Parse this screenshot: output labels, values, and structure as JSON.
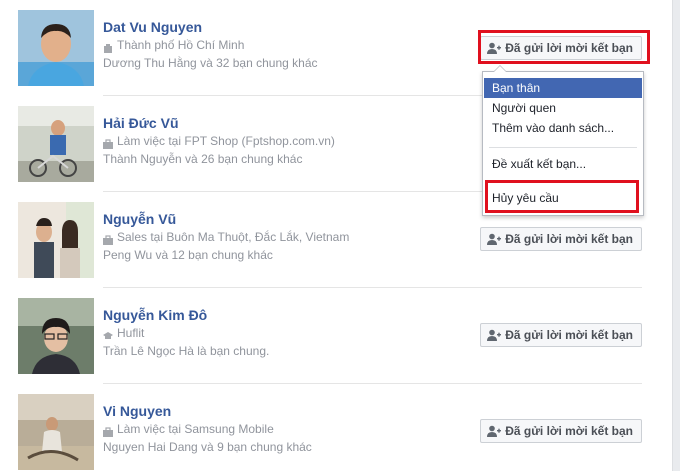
{
  "people": [
    {
      "name": "Dat Vu Nguyen",
      "detail": "Thành phố Hồ Chí Minh",
      "mutual": "Dương Thu Hằng và 32 bạn chung khác",
      "button": "Đã gửi lời mời kết bạn"
    },
    {
      "name": "Hải Đức Vũ",
      "detail": "Làm việc tại FPT Shop (Fptshop.com.vn)",
      "mutual": "Thành Nguyễn và 26 bạn chung khác",
      "button": ""
    },
    {
      "name": "Nguyễn Vũ",
      "detail": "Sales tại Buôn Ma Thuột, Đắc Lắk, Vietnam",
      "mutual": "Peng Wu và 12 bạn chung khác",
      "button": "Đã gửi lời mời kết bạn"
    },
    {
      "name": "Nguyễn Kim Đô",
      "detail": "Huflit",
      "mutual": "Trần Lê Ngọc Hà là bạn chung.",
      "button": "Đã gửi lời mời kết bạn"
    },
    {
      "name": "Vi Nguyen",
      "detail": "Làm việc tại Samsung Mobile",
      "mutual": "Nguyen Hai Dang và 9 bạn chung khác",
      "button": "Đã gửi lời mời kết bạn"
    }
  ],
  "menu": {
    "items": [
      "Bạn thân",
      "Người quen",
      "Thêm vào danh sách...",
      "Đề xuất kết bạn...",
      "Hủy yêu cầu"
    ],
    "active_index": 0
  },
  "icons": {
    "location": "location-icon",
    "work": "briefcase-icon",
    "school": "school-icon",
    "friend_request": "add-friend-icon"
  },
  "colors": {
    "name_link": "#365899",
    "secondary_text": "#90949c",
    "menu_active": "#4267b2",
    "annotation_box": "#e0101e"
  }
}
